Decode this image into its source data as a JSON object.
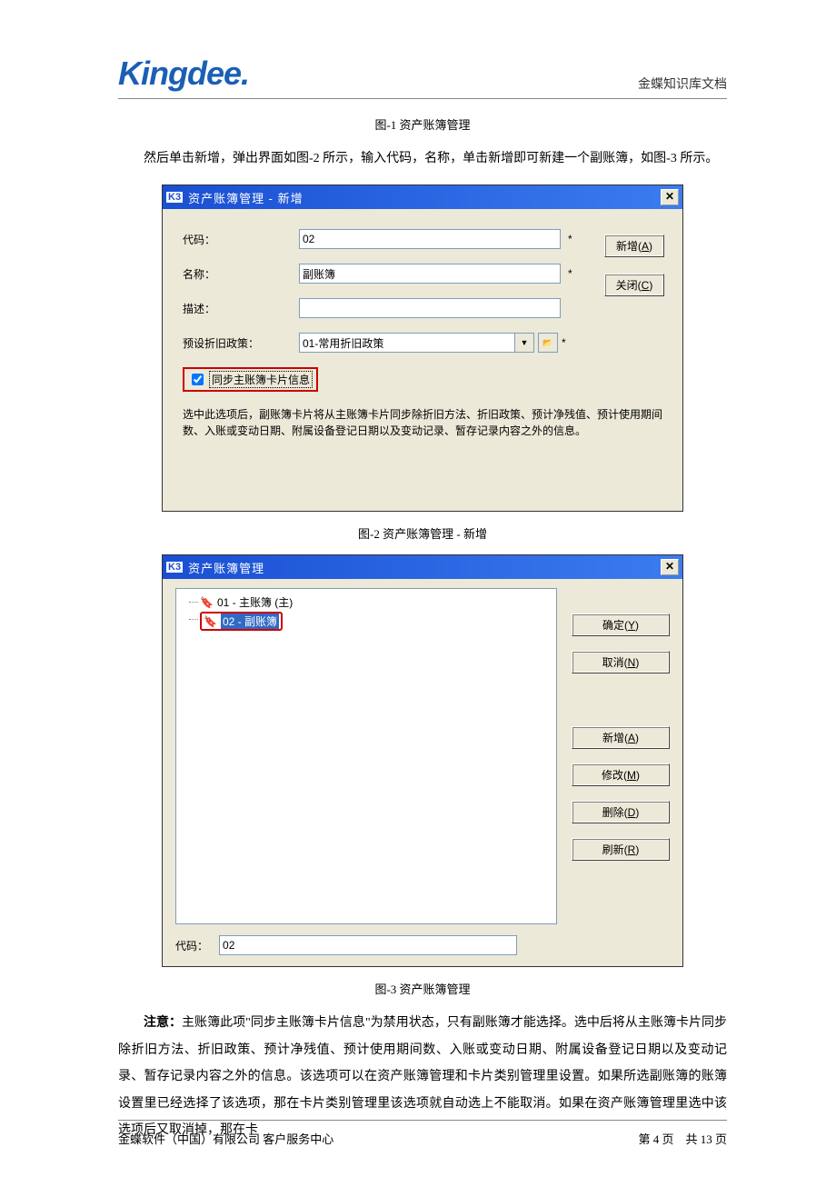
{
  "header": {
    "logo": "Kingdee",
    "docTitle": "金蝶知识库文档"
  },
  "fig1": {
    "caption": "图-1   资产账簿管理"
  },
  "para1": "然后单击新增，弹出界面如图-2 所示，输入代码，名称，单击新增即可新建一个副账簿，如图-3 所示。",
  "dialog1": {
    "title": "资产账簿管理 - 新增",
    "labels": {
      "code": "代码：",
      "name": "名称：",
      "desc": "描述：",
      "policy": "预设折旧政策："
    },
    "values": {
      "code": "02",
      "name": "副账簿",
      "desc": "",
      "policy": "01-常用折旧政策"
    },
    "star": "*",
    "buttons": {
      "add": "新增(A)",
      "close": "关闭(C)"
    },
    "checkbox": "同步主账簿卡片信息",
    "checkboxNote": "选中此选项后，副账簿卡片将从主账簿卡片同步除折旧方法、折旧政策、预计净残值、预计使用期间数、入账或变动日期、附属设备登记日期以及变动记录、暂存记录内容之外的信息。"
  },
  "fig2": {
    "caption": "图-2   资产账簿管理 - 新增"
  },
  "dialog2": {
    "title": "资产账簿管理",
    "treeItems": [
      "01 - 主账簿 (主)",
      "02 - 副账簿"
    ],
    "codeLabel": "代码：",
    "codeValue": "02",
    "buttons": {
      "ok": "确定(Y)",
      "cancel": "取消(N)",
      "add": "新增(A)",
      "modify": "修改(M)",
      "delete": "删除(D)",
      "refresh": "刷新(R)"
    }
  },
  "fig3": {
    "caption": "图-3   资产账簿管理"
  },
  "noteLabel": "注意：",
  "para2": "主账簿此项\"同步主账簿卡片信息\"为禁用状态，只有副账簿才能选择。选中后将从主账簿卡片同步除折旧方法、折旧政策、预计净残值、预计使用期间数、入账或变动日期、附属设备登记日期以及变动记录、暂存记录内容之外的信息。该选项可以在资产账簿管理和卡片类别管理里设置。如果所选副账簿的账簿设置里已经选择了该选项，那在卡片类别管理里该选项就自动选上不能取消。如果在资产账簿管理里选中该选项后又取消掉，那在卡",
  "footer": {
    "left": "金蝶软件（中国）有限公司   客户服务中心",
    "rightA": "第 4 页",
    "rightB": "共 13 页"
  }
}
